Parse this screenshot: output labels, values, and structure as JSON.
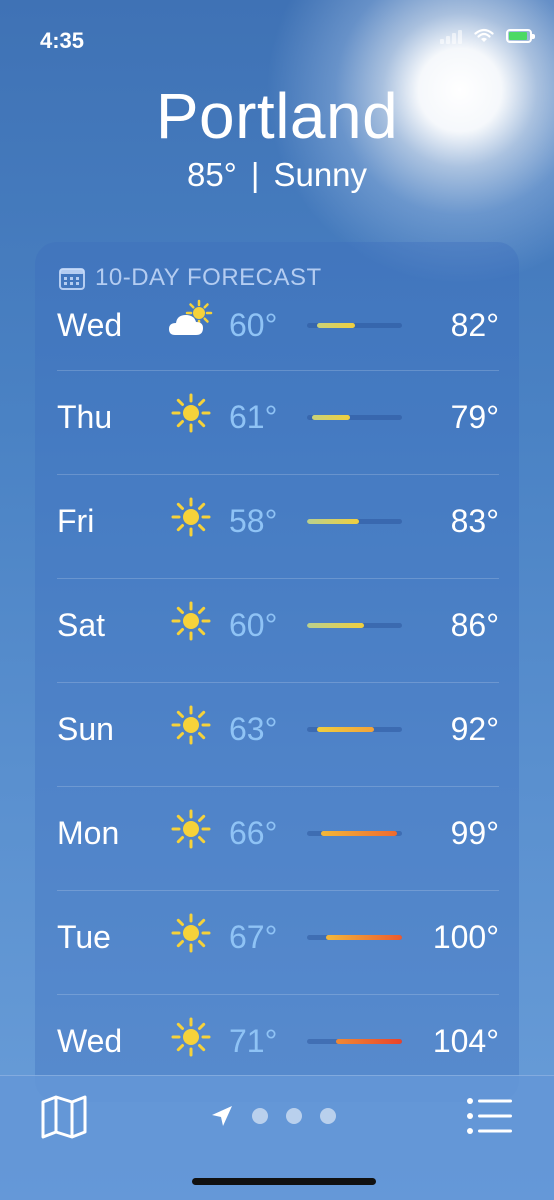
{
  "status_bar": {
    "time": "4:35"
  },
  "location": {
    "city": "Portland",
    "temperature": "85°",
    "separator": "|",
    "condition": "Sunny"
  },
  "forecast": {
    "title": "10-DAY FORECAST",
    "days": [
      {
        "day": "Wed",
        "icon": "partly-cloudy-icon",
        "low": "60°",
        "high": "82°",
        "range_start": 0.1,
        "range_end": 0.5,
        "bar_colors": [
          "#c9d27a",
          "#f0cf3e"
        ]
      },
      {
        "day": "Thu",
        "icon": "sun-icon",
        "low": "61°",
        "high": "79°",
        "range_start": 0.05,
        "range_end": 0.45,
        "bar_colors": [
          "#c9d27a",
          "#f0cf3e"
        ]
      },
      {
        "day": "Fri",
        "icon": "sun-icon",
        "low": "58°",
        "high": "83°",
        "range_start": 0.0,
        "range_end": 0.55,
        "bar_colors": [
          "#b9d08f",
          "#f0cf3e"
        ]
      },
      {
        "day": "Sat",
        "icon": "sun-icon",
        "low": "60°",
        "high": "86°",
        "range_start": 0.0,
        "range_end": 0.6,
        "bar_colors": [
          "#b9d08f",
          "#f0cf3e"
        ]
      },
      {
        "day": "Sun",
        "icon": "sun-icon",
        "low": "63°",
        "high": "92°",
        "range_start": 0.1,
        "range_end": 0.7,
        "bar_colors": [
          "#f0cf3e",
          "#f3a23a"
        ]
      },
      {
        "day": "Mon",
        "icon": "sun-icon",
        "low": "66°",
        "high": "99°",
        "range_start": 0.15,
        "range_end": 0.95,
        "bar_colors": [
          "#f3b83a",
          "#ee6a2e"
        ]
      },
      {
        "day": "Tue",
        "icon": "sun-icon",
        "low": "67°",
        "high": "100°",
        "range_start": 0.2,
        "range_end": 1.0,
        "bar_colors": [
          "#f3b83a",
          "#ee5a2e"
        ]
      },
      {
        "day": "Wed",
        "icon": "sun-icon",
        "low": "71°",
        "high": "104°",
        "range_start": 0.3,
        "range_end": 1.0,
        "bar_colors": [
          "#f08a35",
          "#e8432c"
        ]
      }
    ]
  },
  "bottom_bar": {
    "map_icon": "map-icon",
    "location_icon": "location-arrow-icon",
    "page_dots": 3,
    "list_icon": "list-icon"
  },
  "colors": {
    "background": "#4a82c4",
    "low_temp": "#8fc3f5",
    "sun": "#f6d23a"
  }
}
